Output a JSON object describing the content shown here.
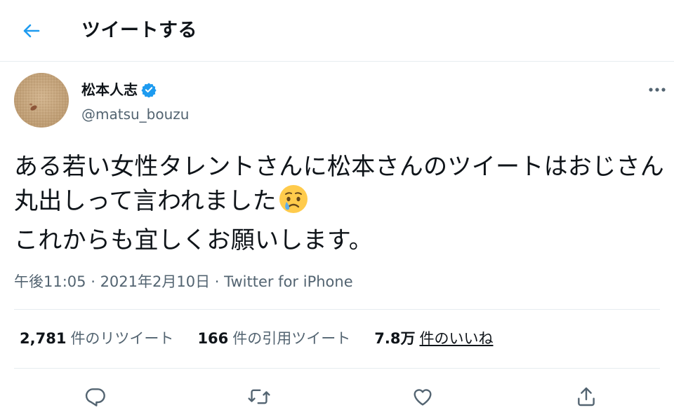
{
  "header": {
    "title": "ツイートする",
    "back_icon": "arrow-left-icon",
    "accent": "#1d9bf0"
  },
  "author": {
    "name": "松本人志",
    "handle": "@matsu_bouzu",
    "verified": true,
    "verified_color": "#1d9bf0"
  },
  "tweet": {
    "text": "ある若い女性タレントさんに松本さんのツイートはおじさん丸出しって言われました",
    "emoji": "crying-face",
    "text2": "これからも宜しくお願いします。"
  },
  "meta": {
    "time": "午後11:05",
    "sep1": " · ",
    "date": "2021年2月10日",
    "sep2": " · ",
    "source": "Twitter for iPhone"
  },
  "stats": {
    "retweets": {
      "count": "2,781",
      "label": "件のリツイート"
    },
    "quotes": {
      "count": "166",
      "label": "件の引用ツイート"
    },
    "likes": {
      "count": "7.8万",
      "label": "件のいいね"
    }
  },
  "actions": [
    "reply-icon",
    "retweet-icon",
    "like-icon",
    "share-icon"
  ],
  "colors": {
    "text": "#0f1419",
    "secondary": "#536471",
    "border": "#e6ecf0",
    "icon": "#536471"
  }
}
